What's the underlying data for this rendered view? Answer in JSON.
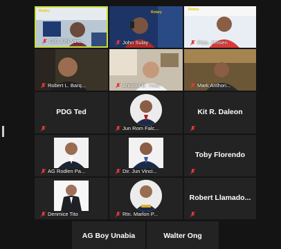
{
  "colors": {
    "background": "#141414",
    "tile": "#232323",
    "active_border": "#c8e03a",
    "muted_icon": "#e03a3a"
  },
  "participants": [
    {
      "name": "C/E JUN Vinc...",
      "type": "video",
      "muted": true,
      "active": true
    },
    {
      "name": "John Sulay",
      "type": "video",
      "muted": true
    },
    {
      "name": "Pres. Jensen",
      "type": "video",
      "muted": true
    },
    {
      "name": "Robert L. Barq...",
      "type": "video",
      "muted": true
    },
    {
      "name": "Antonio D. Ynoc",
      "type": "video",
      "muted": true
    },
    {
      "name": "Mark Anthon...",
      "type": "video",
      "muted": true
    },
    {
      "name": "PDG Ted",
      "type": "name",
      "muted": true
    },
    {
      "name": "Jun Rom Falc...",
      "type": "photo",
      "muted": true
    },
    {
      "name": "Kit R. Daleon",
      "type": "name",
      "muted": true
    },
    {
      "name": "AG Rodlen Pa...",
      "type": "photo",
      "muted": true
    },
    {
      "name": "Dir. Jun Vinci...",
      "type": "photo",
      "muted": true
    },
    {
      "name": "Toby Florendo",
      "type": "name",
      "muted": true
    },
    {
      "name": "Denmice Tito",
      "type": "photo",
      "muted": true
    },
    {
      "name": "Rtn. Marlon P...",
      "type": "photo",
      "muted": true
    },
    {
      "name": "Robert Llamado...",
      "type": "name",
      "muted": true
    },
    {
      "name": "AG Boy Unabia",
      "type": "name",
      "muted": false
    },
    {
      "name": "Walter Ong",
      "type": "name",
      "muted": false
    }
  ],
  "icons": {
    "muted_mic": "mic-muted-icon",
    "drag_handle": "resize-handle"
  },
  "overlay_text": {
    "rotary_small": "Rotary"
  }
}
